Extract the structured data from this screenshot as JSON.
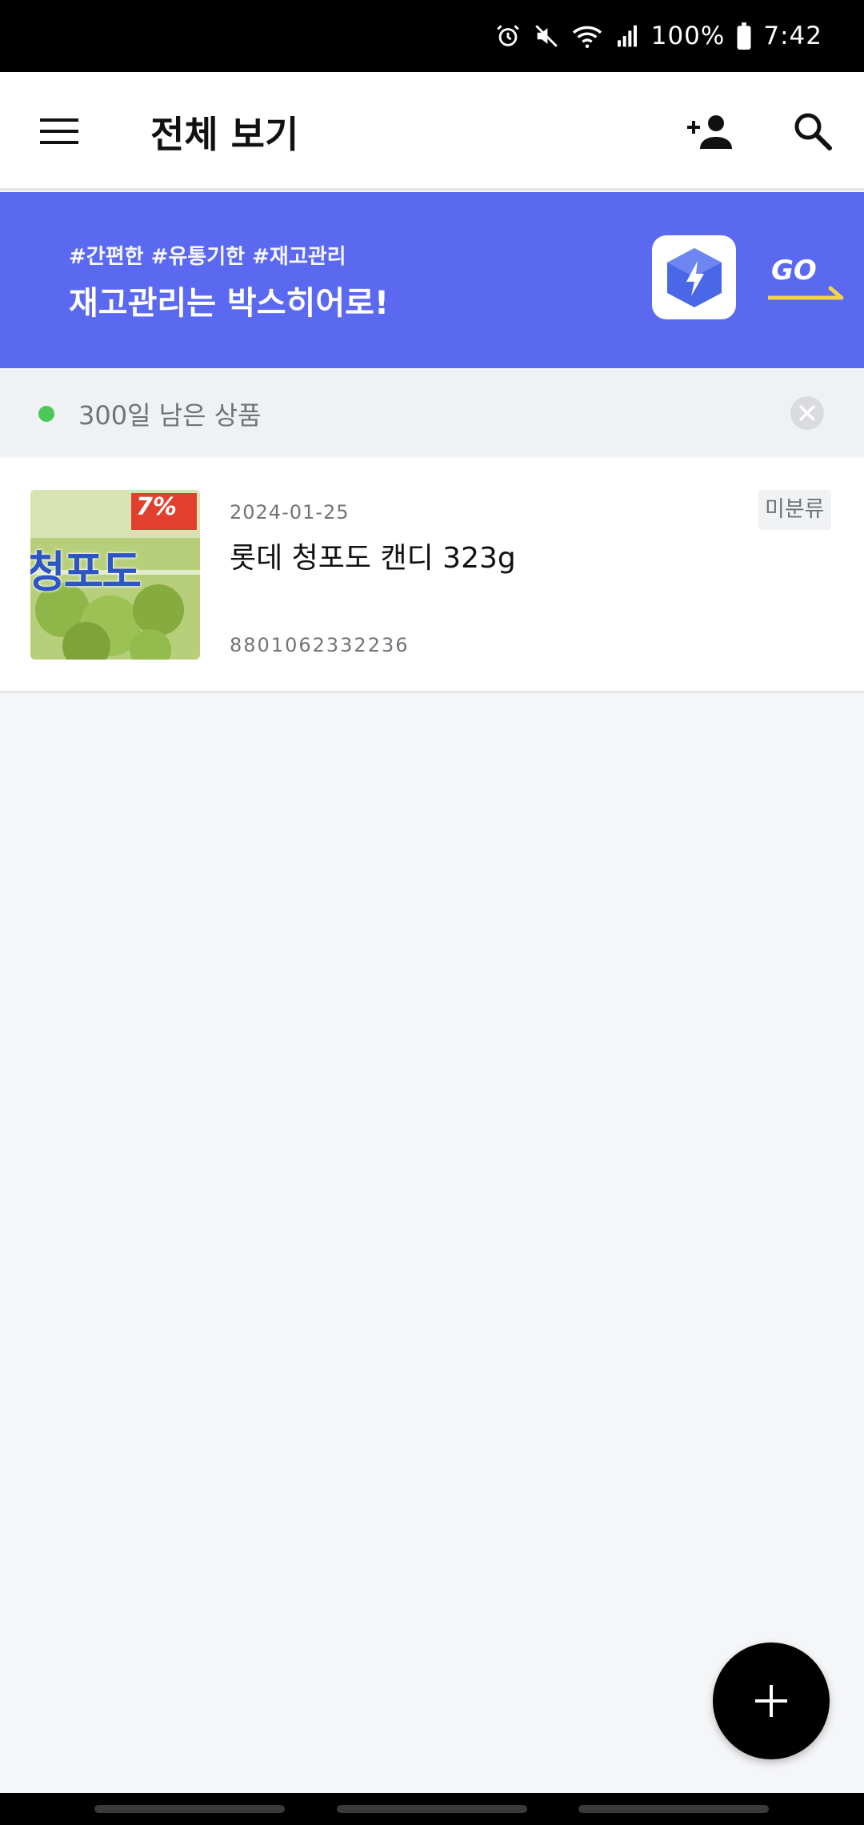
{
  "status_bar": {
    "battery_percent": "100%",
    "time": "7:42",
    "icons": [
      "alarm-icon",
      "mute-icon",
      "wifi-icon",
      "signal-icon",
      "battery-icon"
    ]
  },
  "app_bar": {
    "title": "전체 보기",
    "icons": [
      "menu-icon",
      "add-person-icon",
      "search-icon"
    ]
  },
  "banner": {
    "tags": "#간편한 #유통기한 #재고관리",
    "headline": "재고관리는 박스히어로!",
    "go_label": "GO",
    "background_color": "#5b68f0",
    "accent_color": "#f3d34a"
  },
  "filter": {
    "label": "300일 남은 상품",
    "dot_color": "#4cc85a"
  },
  "items": [
    {
      "date": "2024-01-25",
      "name": "롯데 청포도 캔디 323g",
      "barcode": "8801062332236",
      "category": "미분류",
      "thumbnail_text": "청포도",
      "thumbnail_badge": "7%"
    }
  ],
  "fab": {
    "icon": "plus-icon"
  }
}
